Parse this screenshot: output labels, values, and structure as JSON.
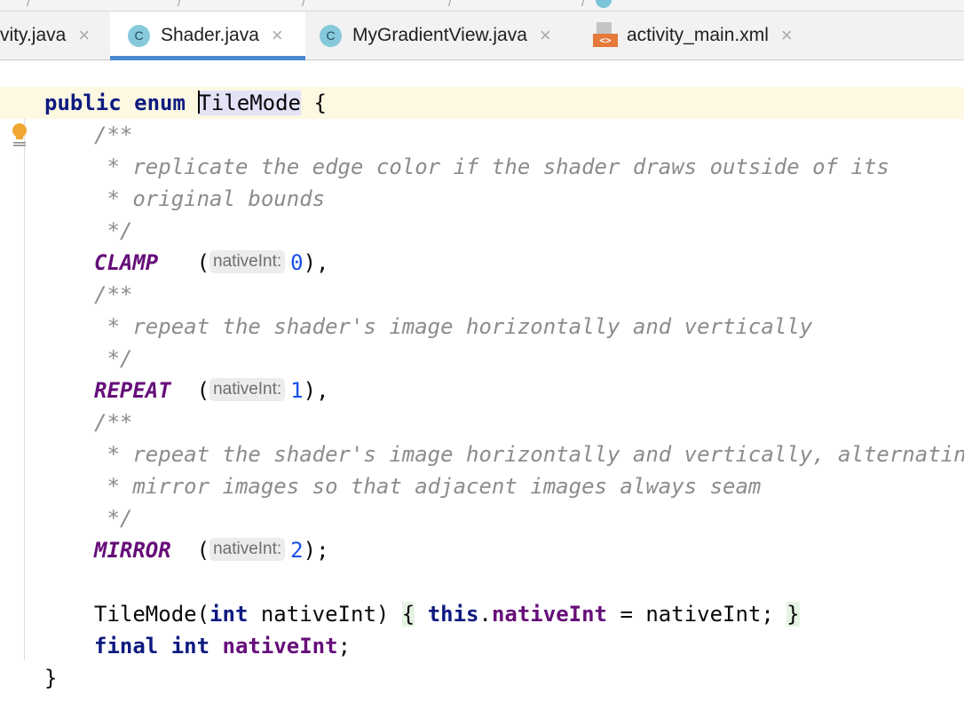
{
  "tabs": [
    {
      "label": "vity.java",
      "icon": "java-class-icon",
      "active": false
    },
    {
      "label": "Shader.java",
      "icon": "java-class-icon",
      "active": true,
      "icon_letter": "C"
    },
    {
      "label": "MyGradientView.java",
      "icon": "java-class-icon",
      "active": false,
      "icon_letter": "C"
    },
    {
      "label": "activity_main.xml",
      "icon": "xml-file-icon",
      "active": false,
      "icon_badge": "<>"
    }
  ],
  "close_glyph": "×",
  "code": {
    "l1_public": "public",
    "l1_enum": "enum",
    "l1_name": "TileMode",
    "l1_brace": " {",
    "c1_open": "/**",
    "c1_l1": " * replicate the edge color if the shader draws outside of its",
    "c1_l2": " * original bounds",
    "c1_close": " */",
    "clamp_name": "CLAMP",
    "clamp_value": "0",
    "c2_open": "/**",
    "c2_l1": " * repeat the shader's image horizontally and vertically",
    "c2_close": " */",
    "repeat_name": "REPEAT",
    "repeat_value": "1",
    "c3_open": "/**",
    "c3_l1": " * repeat the shader's image horizontally and vertically, alternating",
    "c3_l2": " * mirror images so that adjacent images always seam",
    "c3_close": " */",
    "mirror_name": "MIRROR",
    "mirror_value": "2",
    "hint_label": "nativeInt:",
    "ctor_name": "TileMode(",
    "ctor_int": "int",
    "ctor_param": " nativeInt) ",
    "ctor_open": "{",
    "ctor_this": "this",
    "ctor_dot": ".",
    "ctor_field": "nativeInt",
    "ctor_assign": " = nativeInt;",
    "ctor_close": "}",
    "field_final": "final",
    "field_int": "int",
    "field_name": "nativeInt",
    "field_semi": ";",
    "close_brace": "}"
  },
  "colors": {
    "keyword": "#0d1a80",
    "comment": "#8c8c8c",
    "enum_constant": "#660e7a",
    "number": "#1750eb",
    "caret_row": "#fdf8e2",
    "active_tab_underline": "#4a89d0"
  }
}
